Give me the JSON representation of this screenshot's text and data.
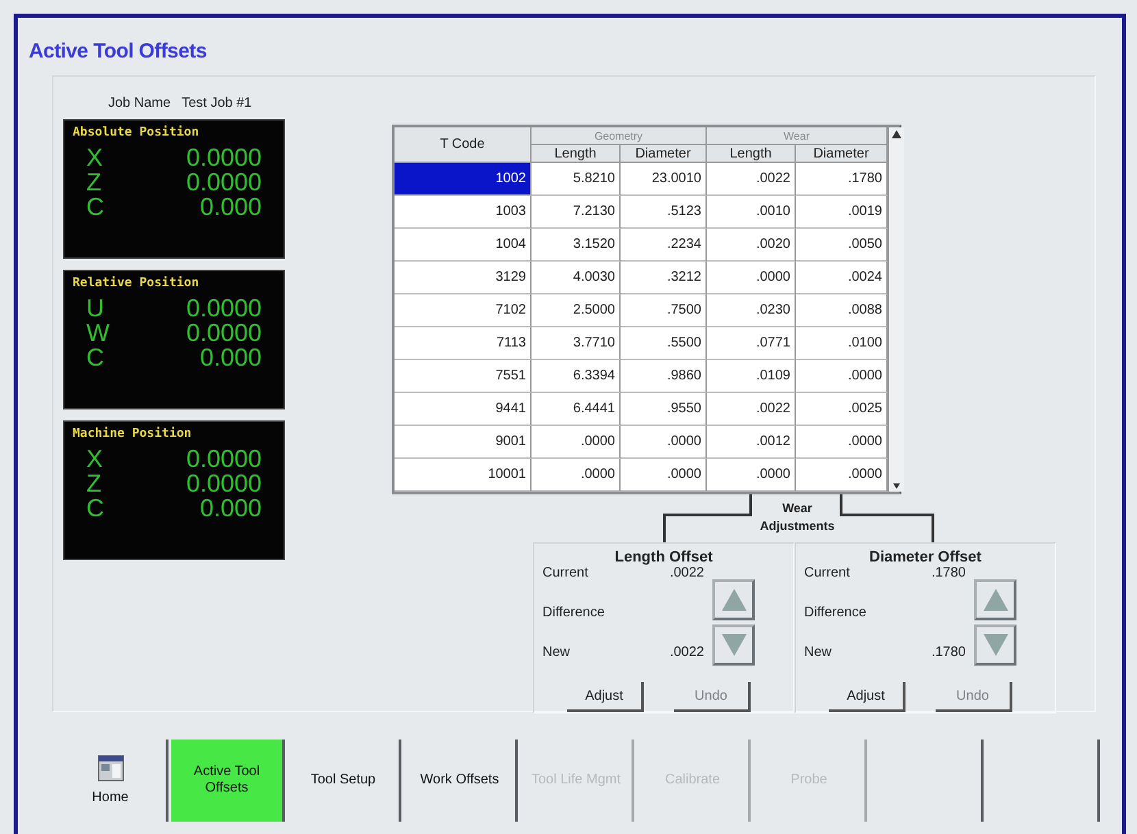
{
  "title": "Active Tool Offsets",
  "job": {
    "label": "Job Name",
    "value": "Test Job #1"
  },
  "positions": [
    {
      "title": "Absolute Position",
      "axes": [
        {
          "axis": "X",
          "value": "0.0000"
        },
        {
          "axis": "Z",
          "value": "0.0000"
        },
        {
          "axis": "C",
          "value": "0.000"
        }
      ]
    },
    {
      "title": "Relative Position",
      "axes": [
        {
          "axis": "U",
          "value": "0.0000"
        },
        {
          "axis": "W",
          "value": "0.0000"
        },
        {
          "axis": "C",
          "value": "0.000"
        }
      ]
    },
    {
      "title": "Machine Position",
      "axes": [
        {
          "axis": "X",
          "value": "0.0000"
        },
        {
          "axis": "Z",
          "value": "0.0000"
        },
        {
          "axis": "C",
          "value": "0.000"
        }
      ]
    }
  ],
  "table": {
    "key_column": "T Code",
    "groups": [
      {
        "label": "Geometry",
        "columns": [
          "Length",
          "Diameter"
        ]
      },
      {
        "label": "Wear",
        "columns": [
          "Length",
          "Diameter"
        ]
      }
    ],
    "rows": [
      {
        "selected": true,
        "cells": [
          "1002",
          "5.8210",
          "23.0010",
          ".0022",
          ".1780"
        ]
      },
      {
        "selected": false,
        "cells": [
          "1003",
          "7.2130",
          ".5123",
          ".0010",
          ".0019"
        ]
      },
      {
        "selected": false,
        "cells": [
          "1004",
          "3.1520",
          ".2234",
          ".0020",
          ".0050"
        ]
      },
      {
        "selected": false,
        "cells": [
          "3129",
          "4.0030",
          ".3212",
          ".0000",
          ".0024"
        ]
      },
      {
        "selected": false,
        "cells": [
          "7102",
          "2.5000",
          ".7500",
          ".0230",
          ".0088"
        ]
      },
      {
        "selected": false,
        "cells": [
          "7113",
          "3.7710",
          ".5500",
          ".0771",
          ".0100"
        ]
      },
      {
        "selected": false,
        "cells": [
          "7551",
          "6.3394",
          ".9860",
          ".0109",
          ".0000"
        ]
      },
      {
        "selected": false,
        "cells": [
          "9441",
          "6.4441",
          ".9550",
          ".0022",
          ".0025"
        ]
      },
      {
        "selected": false,
        "cells": [
          "9001",
          ".0000",
          ".0000",
          ".0012",
          ".0000"
        ]
      },
      {
        "selected": false,
        "cells": [
          "10001",
          ".0000",
          ".0000",
          ".0000",
          ".0000"
        ]
      }
    ]
  },
  "wear": {
    "title": "Wear Adjustments",
    "panels": [
      {
        "title": "Length Offset",
        "fields": [
          {
            "label": "Current",
            "value": ".0022"
          },
          {
            "label": "Difference"
          },
          {
            "label": "New",
            "value": ".0022"
          }
        ],
        "buttons": [
          {
            "label": "Adjust",
            "disabled": false
          },
          {
            "label": "Undo",
            "disabled": true
          }
        ]
      },
      {
        "title": "Diameter Offset",
        "fields": [
          {
            "label": "Current",
            "value": ".1780"
          },
          {
            "label": "Difference"
          },
          {
            "label": "New",
            "value": ".1780"
          }
        ],
        "buttons": [
          {
            "label": "Adjust",
            "disabled": false
          },
          {
            "label": "Undo",
            "disabled": true
          }
        ]
      }
    ]
  },
  "nav": [
    {
      "kind": "icon",
      "label": "Home",
      "selected": false,
      "disabled": false
    },
    {
      "kind": "text",
      "label": "Active Tool Offsets",
      "selected": true,
      "disabled": false
    },
    {
      "kind": "text",
      "label": "Tool Setup",
      "selected": false,
      "disabled": false
    },
    {
      "kind": "text",
      "label": "Work Offsets",
      "selected": false,
      "disabled": false
    },
    {
      "kind": "text",
      "label": "Tool Life Mgmt",
      "selected": false,
      "disabled": true
    },
    {
      "kind": "text",
      "label": "Calibrate",
      "selected": false,
      "disabled": true
    },
    {
      "kind": "text",
      "label": "Probe",
      "selected": false,
      "disabled": true
    },
    {
      "kind": "blank",
      "selected": false,
      "disabled": false
    },
    {
      "kind": "blank",
      "selected": false,
      "disabled": false
    }
  ]
}
